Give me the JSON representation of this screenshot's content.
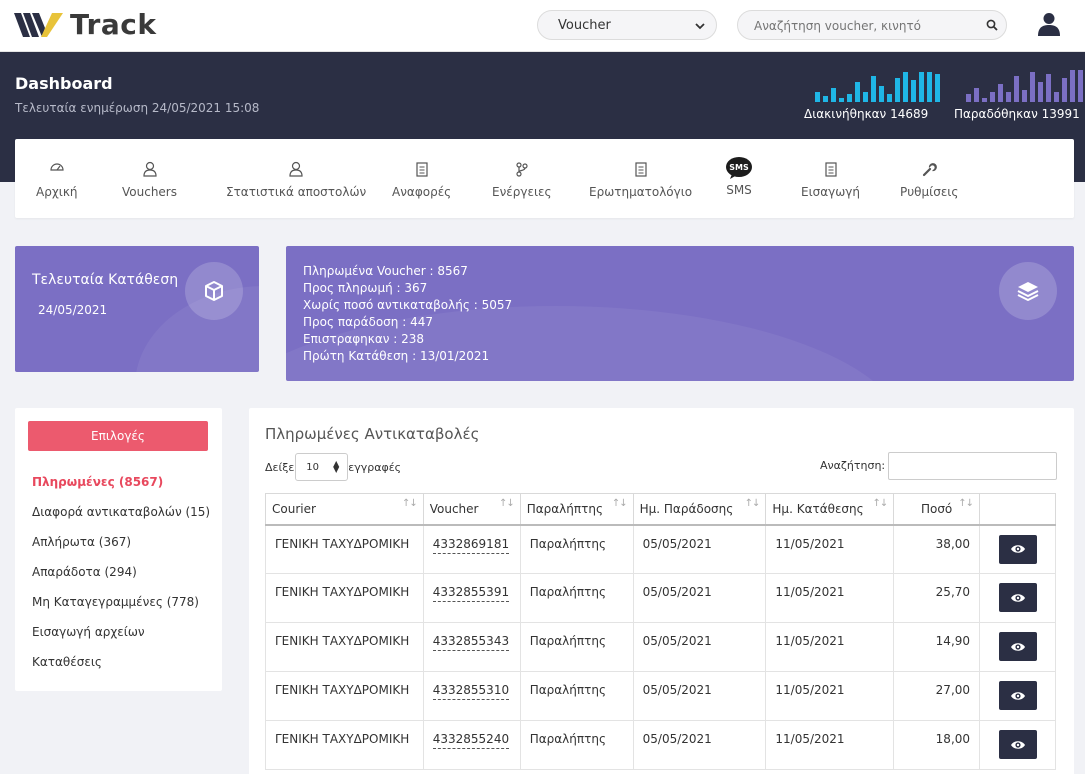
{
  "app": {
    "brand": "Track"
  },
  "header": {
    "select_value": "Voucher",
    "search_placeholder": "Αναζήτηση voucher, κινητό"
  },
  "dashboard": {
    "title": "Dashboard",
    "subtitle": "Τελευταία ενημέρωση 24/05/2021 15:08",
    "stats": [
      {
        "label": "Διακινήθηκαν 14689",
        "color": "#1fb6e6"
      },
      {
        "label": "Παραδόθηκαν 13991",
        "color": "#7b6fc4"
      }
    ]
  },
  "nav": {
    "items": [
      {
        "label": "Αρχική",
        "icon": "home-icon"
      },
      {
        "label": "Vouchers",
        "icon": "user-icon"
      },
      {
        "label": "Στατιστικά αποστολών",
        "icon": "user-icon"
      },
      {
        "label": "Αναφορές",
        "icon": "document-icon"
      },
      {
        "label": "Ενέργειες",
        "icon": "branch-icon"
      },
      {
        "label": "Ερωτηματολόγιο",
        "icon": "document-icon"
      },
      {
        "label": "SMS",
        "icon": "sms-icon"
      },
      {
        "label": "Εισαγωγή",
        "icon": "document-icon"
      },
      {
        "label": "Ρυθμίσεις",
        "icon": "wrench-icon"
      }
    ]
  },
  "last_deposit": {
    "title": "Τελευταία Κατάθεση",
    "date": "24/05/2021"
  },
  "summary": {
    "lines": [
      "Πληρωμένα Voucher : 8567",
      "Προς πληρωμή : 367",
      "Χωρίς ποσό αντικαταβολής : 5057",
      "Προς παράδοση : 447",
      "Επιστραφηκαν : 238",
      "Πρώτη Κατάθεση : 13/01/2021"
    ]
  },
  "left_menu": {
    "button_label": "Επιλογές",
    "items": [
      "Πληρωμένες  (8567)",
      "Διαφορά αντικαταβολών  (15)",
      "Απλήρωτα  (367)",
      "Απαράδοτα  (294)",
      "Μη Καταγεγραμμένες  (778)",
      "Εισαγωγή αρχείων",
      "Καταθέσεις"
    ]
  },
  "table": {
    "title": "Πληρωμένες Αντικαταβολές",
    "show_prefix": "Δείξε",
    "show_value": "10",
    "show_suffix": "εγγραφές",
    "search_label": "Αναζήτηση:",
    "columns": [
      "Courier",
      "Voucher",
      "Παραλήπτης",
      "Ημ. Παράδοσης",
      "Ημ. Κατάθεσης",
      "Ποσό"
    ],
    "rows": [
      {
        "courier": "ΓΕΝΙΚΗ ΤΑΧΥΔΡΟΜΙΚΗ",
        "voucher": "4332869181",
        "recipient": "Παραλήπτης",
        "delivery": "05/05/2021",
        "deposit": "11/05/2021",
        "amount": "38,00"
      },
      {
        "courier": "ΓΕΝΙΚΗ ΤΑΧΥΔΡΟΜΙΚΗ",
        "voucher": "4332855391",
        "recipient": "Παραλήπτης",
        "delivery": "05/05/2021",
        "deposit": "11/05/2021",
        "amount": "25,70"
      },
      {
        "courier": "ΓΕΝΙΚΗ ΤΑΧΥΔΡΟΜΙΚΗ",
        "voucher": "4332855343",
        "recipient": "Παραλήπτης",
        "delivery": "05/05/2021",
        "deposit": "11/05/2021",
        "amount": "14,90"
      },
      {
        "courier": "ΓΕΝΙΚΗ ΤΑΧΥΔΡΟΜΙΚΗ",
        "voucher": "4332855310",
        "recipient": "Παραλήπτης",
        "delivery": "05/05/2021",
        "deposit": "11/05/2021",
        "amount": "27,00"
      },
      {
        "courier": "ΓΕΝΙΚΗ ΤΑΧΥΔΡΟΜΙΚΗ",
        "voucher": "4332855240",
        "recipient": "Παραλήπτης",
        "delivery": "05/05/2021",
        "deposit": "11/05/2021",
        "amount": "18,00"
      }
    ]
  }
}
